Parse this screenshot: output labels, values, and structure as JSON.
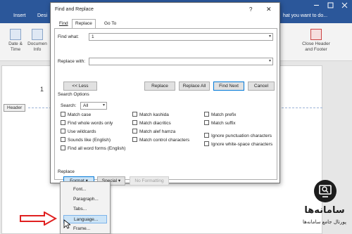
{
  "word": {
    "tabs": [
      "Insert",
      "Desi"
    ],
    "tell_me": "hat you want to do...",
    "ribbon": {
      "date_time": "Date &\nTime",
      "document_info": "Documen\nInfo",
      "close_header_footer": "Close Header\nand Footer"
    },
    "header_tag": "Header",
    "cursor_mark": "1"
  },
  "dialog": {
    "title": "Find and Replace",
    "help": "?",
    "close": "✕",
    "tabs": [
      "Find",
      "Replace",
      "Go To"
    ],
    "find_label": "Find what:",
    "find_value": "1",
    "replace_label": "Replace with:",
    "replace_value": "",
    "buttons": {
      "less": "<< Less",
      "replace": "Replace",
      "replace_all": "Replace All",
      "find_next": "Find Next",
      "cancel": "Cancel"
    },
    "search_options_label": "Search Options",
    "search_label": "Search:",
    "search_value": "All",
    "options_left": [
      "Match case",
      "Find whole words only",
      "Use wildcards",
      "Sounds like (English)",
      "Find all word forms (English)"
    ],
    "options_mid": [
      "Match kashida",
      "Match diacritics",
      "Match alef hamza",
      "Match control characters"
    ],
    "options_right": [
      "Match prefix",
      "Match suffix",
      "Ignore punctuation characters",
      "Ignore white-space characters"
    ],
    "replace_section_label": "Replace",
    "format_label": "Format ▾",
    "special_label": "Special ▾",
    "no_formatting_label": "No Formatting"
  },
  "format_menu": {
    "items": [
      "Font...",
      "Paragraph...",
      "Tabs...",
      "Language...",
      "Frame..."
    ],
    "active_index": 3
  },
  "logo": {
    "name": "سامانه‌ها",
    "tagline": "پورتال جامع سامانه‌ها"
  },
  "colors": {
    "title_bar": "#2b579a",
    "arrow": "#e02020",
    "accent": "#0078d7"
  }
}
